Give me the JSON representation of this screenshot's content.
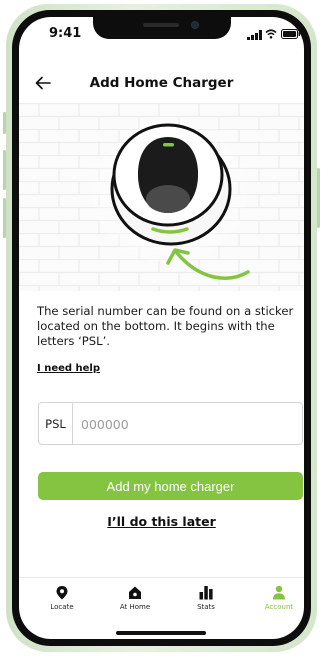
{
  "status_bar": {
    "time": "9:41"
  },
  "header": {
    "title": "Add Home Charger"
  },
  "instructions": {
    "text": "The serial number can be found on a sticker located on the bottom. It begins with the letters ‘PSL’.",
    "help_link": "I need help"
  },
  "serial_field": {
    "prefix": "PSL",
    "placeholder": "000000",
    "value": ""
  },
  "actions": {
    "primary": "Add my home charger",
    "secondary": "I’ll do this later"
  },
  "tabbar": {
    "items": [
      {
        "label": "Locate",
        "icon": "location-pin-icon",
        "active": false
      },
      {
        "label": "At Home",
        "icon": "home-icon",
        "active": false
      },
      {
        "label": "Stats",
        "icon": "bar-chart-icon",
        "active": false
      },
      {
        "label": "Account",
        "icon": "person-icon",
        "active": true
      }
    ]
  },
  "colors": {
    "accent": "#84c441",
    "text": "#111111",
    "frame": "#cfe2c6"
  }
}
